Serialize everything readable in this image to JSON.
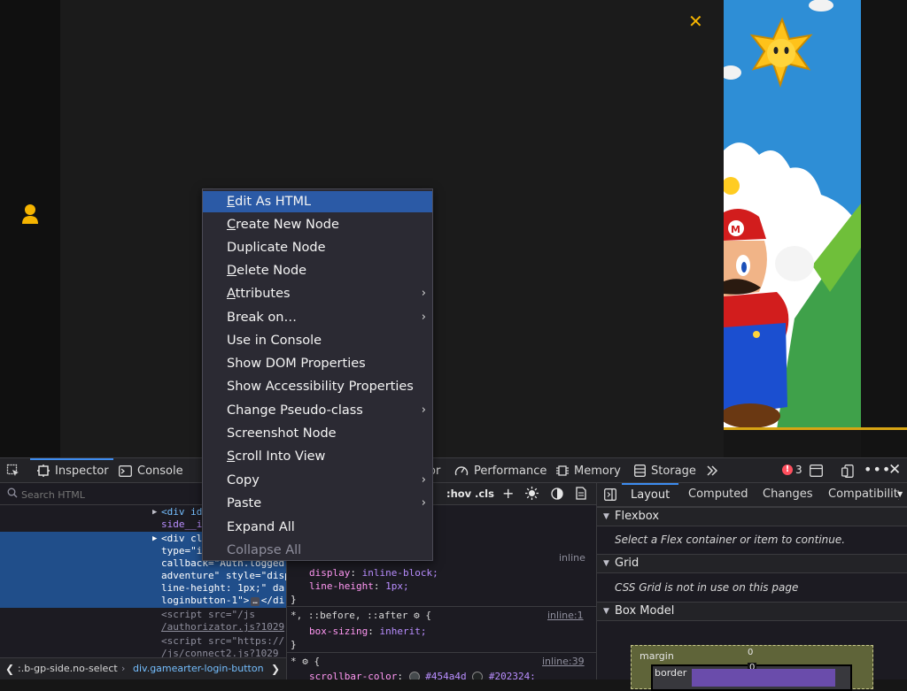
{
  "devtools_tabs": [
    {
      "label": "Inspector",
      "icon": "inspector-icon"
    },
    {
      "label": "Console",
      "icon": "console-icon"
    },
    {
      "label": "or",
      "icon": ""
    },
    {
      "label": "Performance",
      "icon": "performance-icon"
    },
    {
      "label": "Memory",
      "icon": "memory-icon"
    },
    {
      "label": "Storage",
      "icon": "storage-icon"
    }
  ],
  "error_count": "3",
  "markup": {
    "search_placeholder": "Search HTML",
    "lines": [
      {
        "text": "<div id"
      },
      {
        "text": "side__i"
      },
      {
        "text": "<div cl"
      },
      {
        "text": "type=\"i"
      },
      {
        "text": "callback=\"Auth.logged"
      },
      {
        "text": "adventure\" style=\"disp"
      },
      {
        "text": "line-height: 1px;\" da"
      },
      {
        "text": "loginbutton-1\">"
      },
      {
        "text": "</di"
      },
      {
        "text": "<script src=\"/js"
      },
      {
        "text": "/authorizator.js?1029"
      },
      {
        "text": "<script src=\"https://"
      },
      {
        "text": "/js/connect2.js?1029"
      }
    ],
    "ellipsis_badge": "…",
    "breadcrumb": [
      {
        "text": ":.b-gp-side.no-select"
      },
      {
        "text": "div.gamearter-login-button"
      }
    ]
  },
  "rules": {
    "toolbar": {
      "hov": ":hov",
      "cls": ".cls"
    },
    "inline_src": "inline",
    "block1": [
      {
        "prop": "display",
        "val": "inline-block;"
      },
      {
        "prop": "line-height",
        "val": "1px;"
      }
    ],
    "block2": {
      "selector": "*, ::before, ::after",
      "src": "inline:1",
      "prop": "box-sizing",
      "val": "inherit;"
    },
    "block3": {
      "selector": "*",
      "src": "inline:39",
      "prop": "scrollbar-color",
      "val1": "#454a4d",
      "val2": "#202324;"
    },
    "closing_brace": "}"
  },
  "side_tabs": [
    "Layout",
    "Computed",
    "Changes",
    "Compatibility"
  ],
  "layout": {
    "sections": [
      {
        "title": "Flexbox",
        "text": "Select a Flex container or item to continue."
      },
      {
        "title": "Grid",
        "text": "CSS Grid is not in use on this page"
      },
      {
        "title": "Box Model",
        "text": ""
      }
    ],
    "box_model": {
      "margin_label": "margin",
      "margin_top": "0",
      "border_label": "border",
      "border_top": "0"
    }
  },
  "context_menu": [
    {
      "label": "Edit As HTML",
      "accel": "E",
      "rest": "dit As HTML",
      "submenu": false,
      "highlighted": true,
      "disabled": false
    },
    {
      "label": "Create New Node",
      "accel": "C",
      "rest": "reate New Node",
      "submenu": false,
      "highlighted": false,
      "disabled": false
    },
    {
      "label": "Duplicate Node",
      "accel": "",
      "rest": "Duplicate Node",
      "submenu": false,
      "highlighted": false,
      "disabled": false
    },
    {
      "label": "Delete Node",
      "accel": "D",
      "rest": "elete Node",
      "submenu": false,
      "highlighted": false,
      "disabled": false
    },
    {
      "label": "Attributes",
      "accel": "A",
      "rest": "ttributes",
      "submenu": true,
      "highlighted": false,
      "disabled": false
    },
    {
      "label": "Break on…",
      "accel": "",
      "rest": "Break on…",
      "submenu": true,
      "highlighted": false,
      "disabled": false
    },
    {
      "label": "Use in Console",
      "accel": "",
      "rest": "Use in Console",
      "submenu": false,
      "highlighted": false,
      "disabled": false
    },
    {
      "label": "Show DOM Properties",
      "accel": "",
      "rest": "Show DOM Properties",
      "submenu": false,
      "highlighted": false,
      "disabled": false
    },
    {
      "label": "Show Accessibility Properties",
      "accel": "",
      "rest": "Show Accessibility Properties",
      "submenu": false,
      "highlighted": false,
      "disabled": false
    },
    {
      "label": "Change Pseudo-class",
      "accel": "",
      "rest": "Change Pseudo-class",
      "submenu": true,
      "highlighted": false,
      "disabled": false
    },
    {
      "label": "Screenshot Node",
      "accel": "",
      "rest": "Screenshot Node",
      "submenu": false,
      "highlighted": false,
      "disabled": false
    },
    {
      "label": "Scroll Into View",
      "accel": "S",
      "rest": "croll Into View",
      "submenu": false,
      "highlighted": false,
      "disabled": false
    },
    {
      "label": "Copy",
      "accel": "",
      "rest": "Copy",
      "submenu": true,
      "highlighted": false,
      "disabled": false
    },
    {
      "label": "Paste",
      "accel": "",
      "rest": "Paste",
      "submenu": true,
      "highlighted": false,
      "disabled": false
    },
    {
      "label": "Expand All",
      "accel": "",
      "rest": "Expand All",
      "submenu": false,
      "highlighted": false,
      "disabled": false
    },
    {
      "label": "Collapse All",
      "accel": "",
      "rest": "Collapse All",
      "submenu": false,
      "highlighted": false,
      "disabled": true
    }
  ],
  "colors": {
    "accent": "#3d8cf0",
    "selection": "#204e8a",
    "menu_highlight": "#2b5aa6",
    "close_x": "#f5b400"
  }
}
